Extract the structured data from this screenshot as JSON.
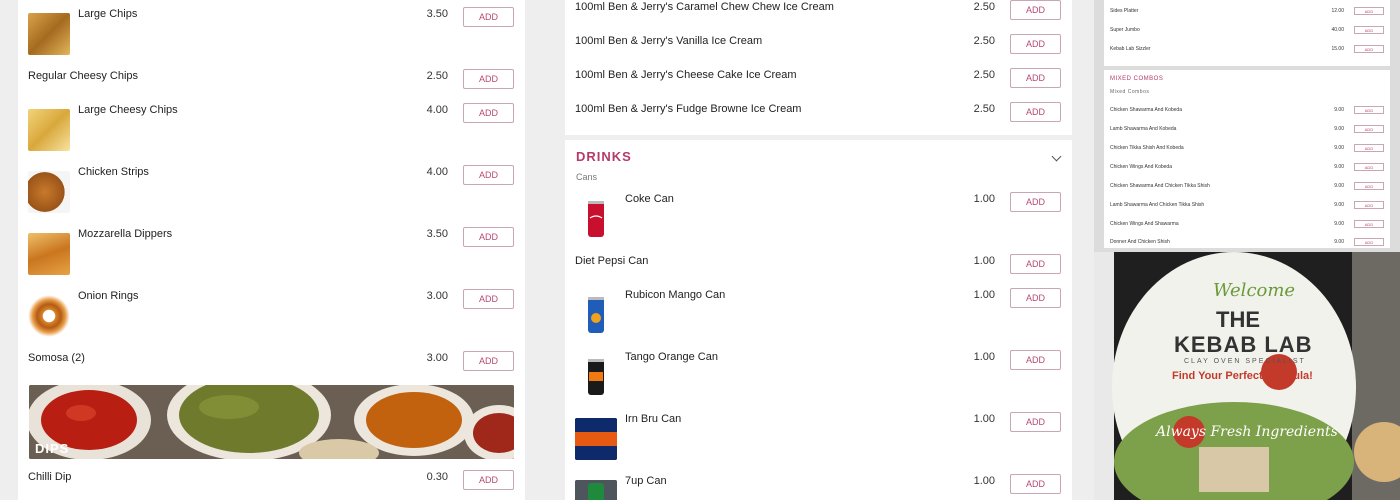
{
  "left_menu": {
    "add_label": "ADD",
    "items": [
      {
        "name": "Large Chips",
        "price": "3.50"
      },
      {
        "name": "Regular Cheesy Chips",
        "price": "2.50"
      },
      {
        "name": "Large Cheesy Chips",
        "price": "4.00"
      },
      {
        "name": "Chicken Strips",
        "price": "4.00"
      },
      {
        "name": "Mozzarella Dippers",
        "price": "3.50"
      },
      {
        "name": "Onion Rings",
        "price": "3.00"
      },
      {
        "name": "Somosa (2)",
        "price": "3.00"
      }
    ],
    "dips_banner": "DIPS",
    "dips_items": [
      {
        "name": "Chilli Dip",
        "price": "0.30"
      }
    ]
  },
  "middle_menu": {
    "add_label": "ADD",
    "ice_cream": [
      {
        "name": "100ml Ben & Jerry's Caramel Chew Chew Ice Cream",
        "price": "2.50"
      },
      {
        "name": "100ml Ben & Jerry's Vanilla Ice Cream",
        "price": "2.50"
      },
      {
        "name": "100ml Ben & Jerry's Cheese Cake Ice Cream",
        "price": "2.50"
      },
      {
        "name": "100ml Ben & Jerry's Fudge Browne Ice Cream",
        "price": "2.50"
      }
    ],
    "drinks_title": "DRINKS",
    "drinks_sub": "Cans",
    "drinks": [
      {
        "name": "Coke Can",
        "price": "1.00"
      },
      {
        "name": "Diet Pepsi Can",
        "price": "1.00"
      },
      {
        "name": "Rubicon Mango Can",
        "price": "1.00"
      },
      {
        "name": "Tango Orange Can",
        "price": "1.00"
      },
      {
        "name": "Irn Bru Can",
        "price": "1.00"
      },
      {
        "name": "7up Can",
        "price": "1.00"
      }
    ]
  },
  "right_panel": {
    "top_rows": [
      {
        "name": "Sides Platter",
        "price": "12.00"
      },
      {
        "name": "Super Jumbo",
        "price": "40.00"
      },
      {
        "name": "Kebab Lab Sizzler",
        "price": "15.00"
      }
    ],
    "mixed_title": "MIXED COMBOS",
    "mixed_sub": "Mixed Combos",
    "mixed_rows": [
      {
        "name": "Chicken Shawarma And Kobeda",
        "price": "9.00"
      },
      {
        "name": "Lamb Shawarma And Kobeda",
        "price": "9.00"
      },
      {
        "name": "Chicken Tikka Shish And Kobeda",
        "price": "9.00"
      },
      {
        "name": "Chicken Wings And Kobeda",
        "price": "9.00"
      },
      {
        "name": "Chicken Shawarma And Chicken Tikka Shish",
        "price": "9.00"
      },
      {
        "name": "Lamb Shawarma And Chicken Tikka Shish",
        "price": "9.00"
      },
      {
        "name": "Chicken Wings And Shawarma",
        "price": "9.00"
      },
      {
        "name": "Donner And Chicken Shish",
        "price": "9.00"
      }
    ],
    "add_label": "ADD",
    "photo": {
      "welcome": "Welcome",
      "the": "THE",
      "brand": "KEBAB LAB",
      "tagline": "CLAY OVEN SPECIALIST",
      "find": "Find Your Perfect Formula!",
      "fresh": "Always Fresh Ingredients"
    }
  },
  "colors": {
    "accent": "#b53a6b",
    "button_border": "#c9a6b6"
  }
}
